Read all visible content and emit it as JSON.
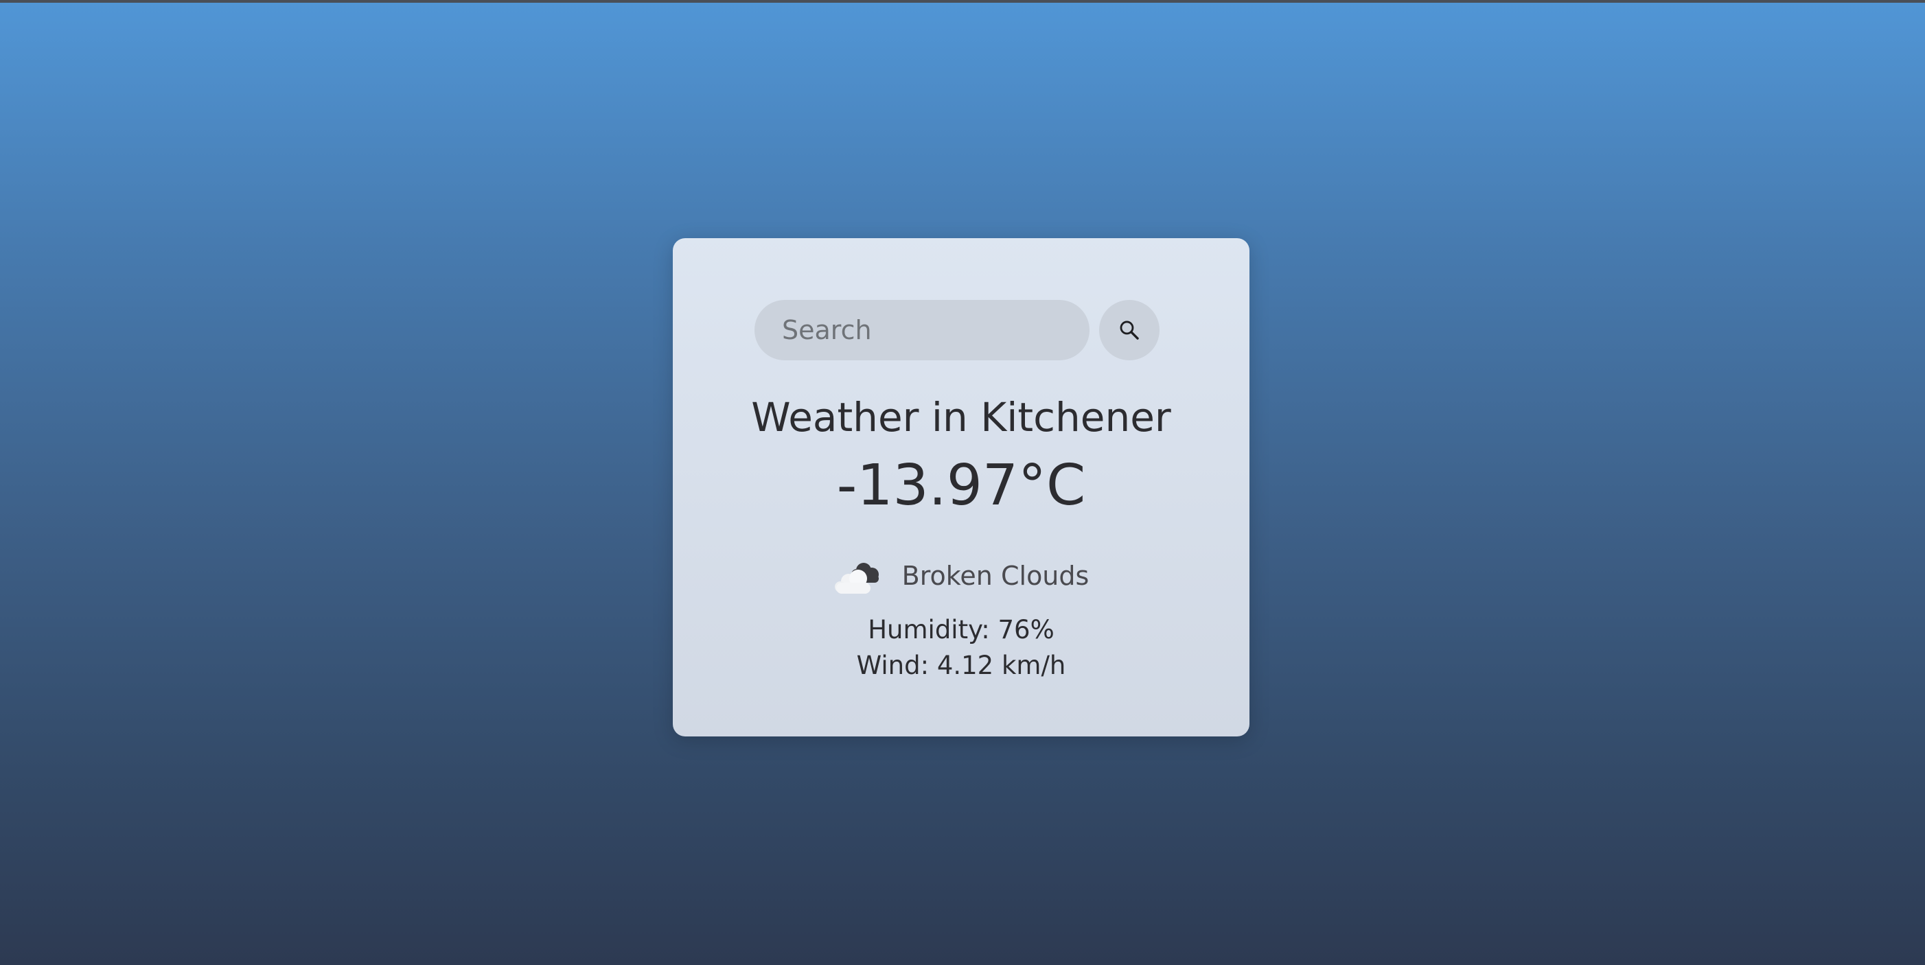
{
  "search": {
    "placeholder": "Search",
    "value": ""
  },
  "weather": {
    "title": "Weather in Kitchener",
    "temperature": "-13.97°C",
    "condition": "Broken Clouds",
    "condition_icon": "broken-clouds-icon",
    "humidity": "Humidity: 76%",
    "wind": "Wind: 4.12 km/h"
  },
  "colors": {
    "background_top": "#5196d6",
    "background_bottom": "#2d3a52",
    "card": "#dce3ee",
    "input": "#cbd2dc",
    "text": "#2c2c30"
  }
}
